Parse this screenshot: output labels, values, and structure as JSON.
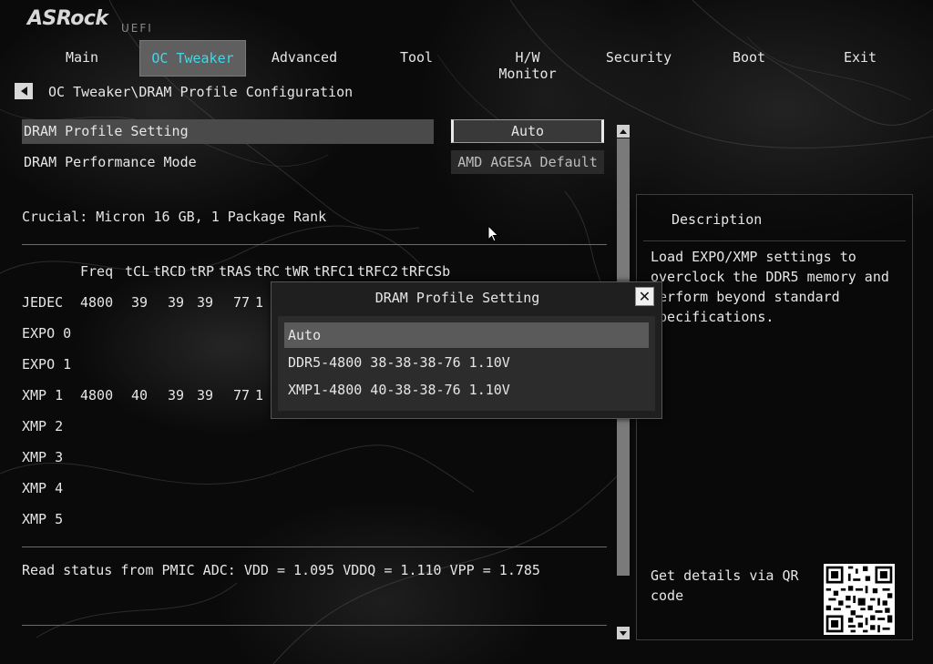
{
  "brand": {
    "logo": "ASRock",
    "sub": "UEFI"
  },
  "nav": {
    "items": [
      "Main",
      "OC Tweaker",
      "Advanced",
      "Tool",
      "H/W Monitor",
      "Security",
      "Boot",
      "Exit"
    ],
    "active": "OC Tweaker",
    "active_color": "#40d8e8"
  },
  "breadcrumb": "OC Tweaker\\DRAM Profile Configuration",
  "settings": [
    {
      "label": "DRAM Profile Setting",
      "value": "Auto"
    },
    {
      "label": "DRAM Performance Mode",
      "value": "AMD AGESA Default"
    }
  ],
  "dimm_info": "Crucial: Micron 16 GB, 1 Package Rank",
  "timings": {
    "headers": [
      "Freq",
      "tCL",
      "tRCD",
      "tRP",
      "tRAS",
      "tRC",
      "tWR",
      "tRFC1",
      "tRFC2",
      "tRFCSb"
    ],
    "rows": [
      {
        "name": "JEDEC",
        "values": [
          "4800",
          "39",
          "39",
          "39",
          "77",
          "1"
        ]
      },
      {
        "name": "EXPO 0",
        "values": []
      },
      {
        "name": "EXPO 1",
        "values": []
      },
      {
        "name": "XMP 1",
        "values": [
          "4800",
          "40",
          "39",
          "39",
          "77",
          "1"
        ]
      },
      {
        "name": "XMP 2",
        "values": []
      },
      {
        "name": "XMP 3",
        "values": []
      },
      {
        "name": "XMP 4",
        "values": []
      },
      {
        "name": "XMP 5",
        "values": []
      }
    ]
  },
  "status_line": "Read status from PMIC ADC: VDD = 1.095 VDDQ = 1.110 VPP = 1.785",
  "description": {
    "title": "Description",
    "text": "Load EXPO/XMP settings to overclock the DDR5 memory and perform beyond standard specifications.",
    "qr_label": "Get details via QR code"
  },
  "modal": {
    "title": "DRAM Profile Setting",
    "options": [
      "Auto",
      "DDR5-4800 38-38-38-76 1.10V",
      "XMP1-4800 40-38-38-76 1.10V"
    ],
    "selected": "Auto"
  },
  "icons": {
    "back": "back-arrow-icon",
    "close": "close-icon",
    "scroll_up": "scroll-up-arrow-icon",
    "scroll_down": "scroll-down-arrow-icon",
    "cursor": "mouse-cursor-icon"
  }
}
